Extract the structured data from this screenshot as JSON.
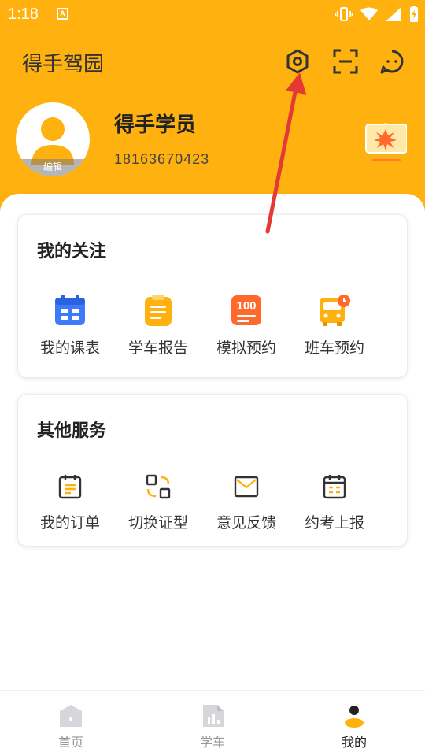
{
  "status_bar": {
    "time": "1:18",
    "notification_badge": "A"
  },
  "header": {
    "app_title": "得手驾园",
    "accent_color": "#FFB20F"
  },
  "header_icons": [
    "settings-hex-icon",
    "scan-icon",
    "message-icon"
  ],
  "profile": {
    "name": "得手学员",
    "phone": "18163670423",
    "edit_label": "编辑"
  },
  "follow_section": {
    "title": "我的关注",
    "items": [
      {
        "label": "我的课表",
        "icon": "schedule-icon",
        "color": "#3E7BFA"
      },
      {
        "label": "学车报告",
        "icon": "report-icon",
        "color": "#FFB20F"
      },
      {
        "label": "模拟预约",
        "icon": "mock-exam-100-icon",
        "color": "#FF6A2C"
      },
      {
        "label": "班车预约",
        "icon": "shuttle-bus-icon",
        "color": "#FFB20F"
      }
    ]
  },
  "other_section": {
    "title": "其他服务",
    "items": [
      {
        "label": "我的订单",
        "icon": "order-icon"
      },
      {
        "label": "切换证型",
        "icon": "switch-license-icon"
      },
      {
        "label": "意见反馈",
        "icon": "feedback-mail-icon"
      },
      {
        "label": "约考上报",
        "icon": "exam-report-calendar-icon"
      }
    ]
  },
  "tabbar": {
    "tabs": [
      {
        "label": "首页",
        "icon": "home-icon",
        "active": false
      },
      {
        "label": "学车",
        "icon": "learn-chart-icon",
        "active": false
      },
      {
        "label": "我的",
        "icon": "profile-icon",
        "active": true
      }
    ]
  },
  "annotation": {
    "arrow_color": "#E53935"
  }
}
